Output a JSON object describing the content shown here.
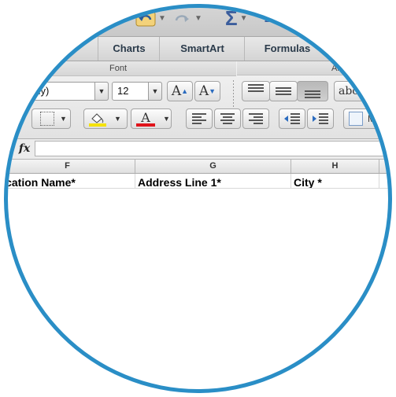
{
  "quick_access": {
    "undo_icon": "undo-icon",
    "redo_icon": "redo-icon",
    "autosum_icon": "sigma-icon",
    "sort_icon": "sort-az-icon"
  },
  "tabs": [
    {
      "label": "Charts"
    },
    {
      "label": "SmartArt"
    },
    {
      "label": "Formulas"
    }
  ],
  "ribbon": {
    "font_group_label": "Font",
    "alignment_group_label": "Al",
    "font_name": "ody)",
    "font_size": "12",
    "grow_font": "A",
    "shrink_font": "A",
    "wrap_text": "abc",
    "merge_partial": "M"
  },
  "formula_bar": {
    "fx_label": "fx",
    "value": ""
  },
  "columns": [
    {
      "label": "F"
    },
    {
      "label": "G"
    },
    {
      "label": "H"
    }
  ],
  "row1": {
    "F": "Location Name*",
    "G": "Address Line 1*",
    "H": "City *"
  },
  "colors": {
    "ring": "#2a8ec6",
    "highlight_bar": "#f5e200",
    "font_color_bar": "#e0141b"
  }
}
